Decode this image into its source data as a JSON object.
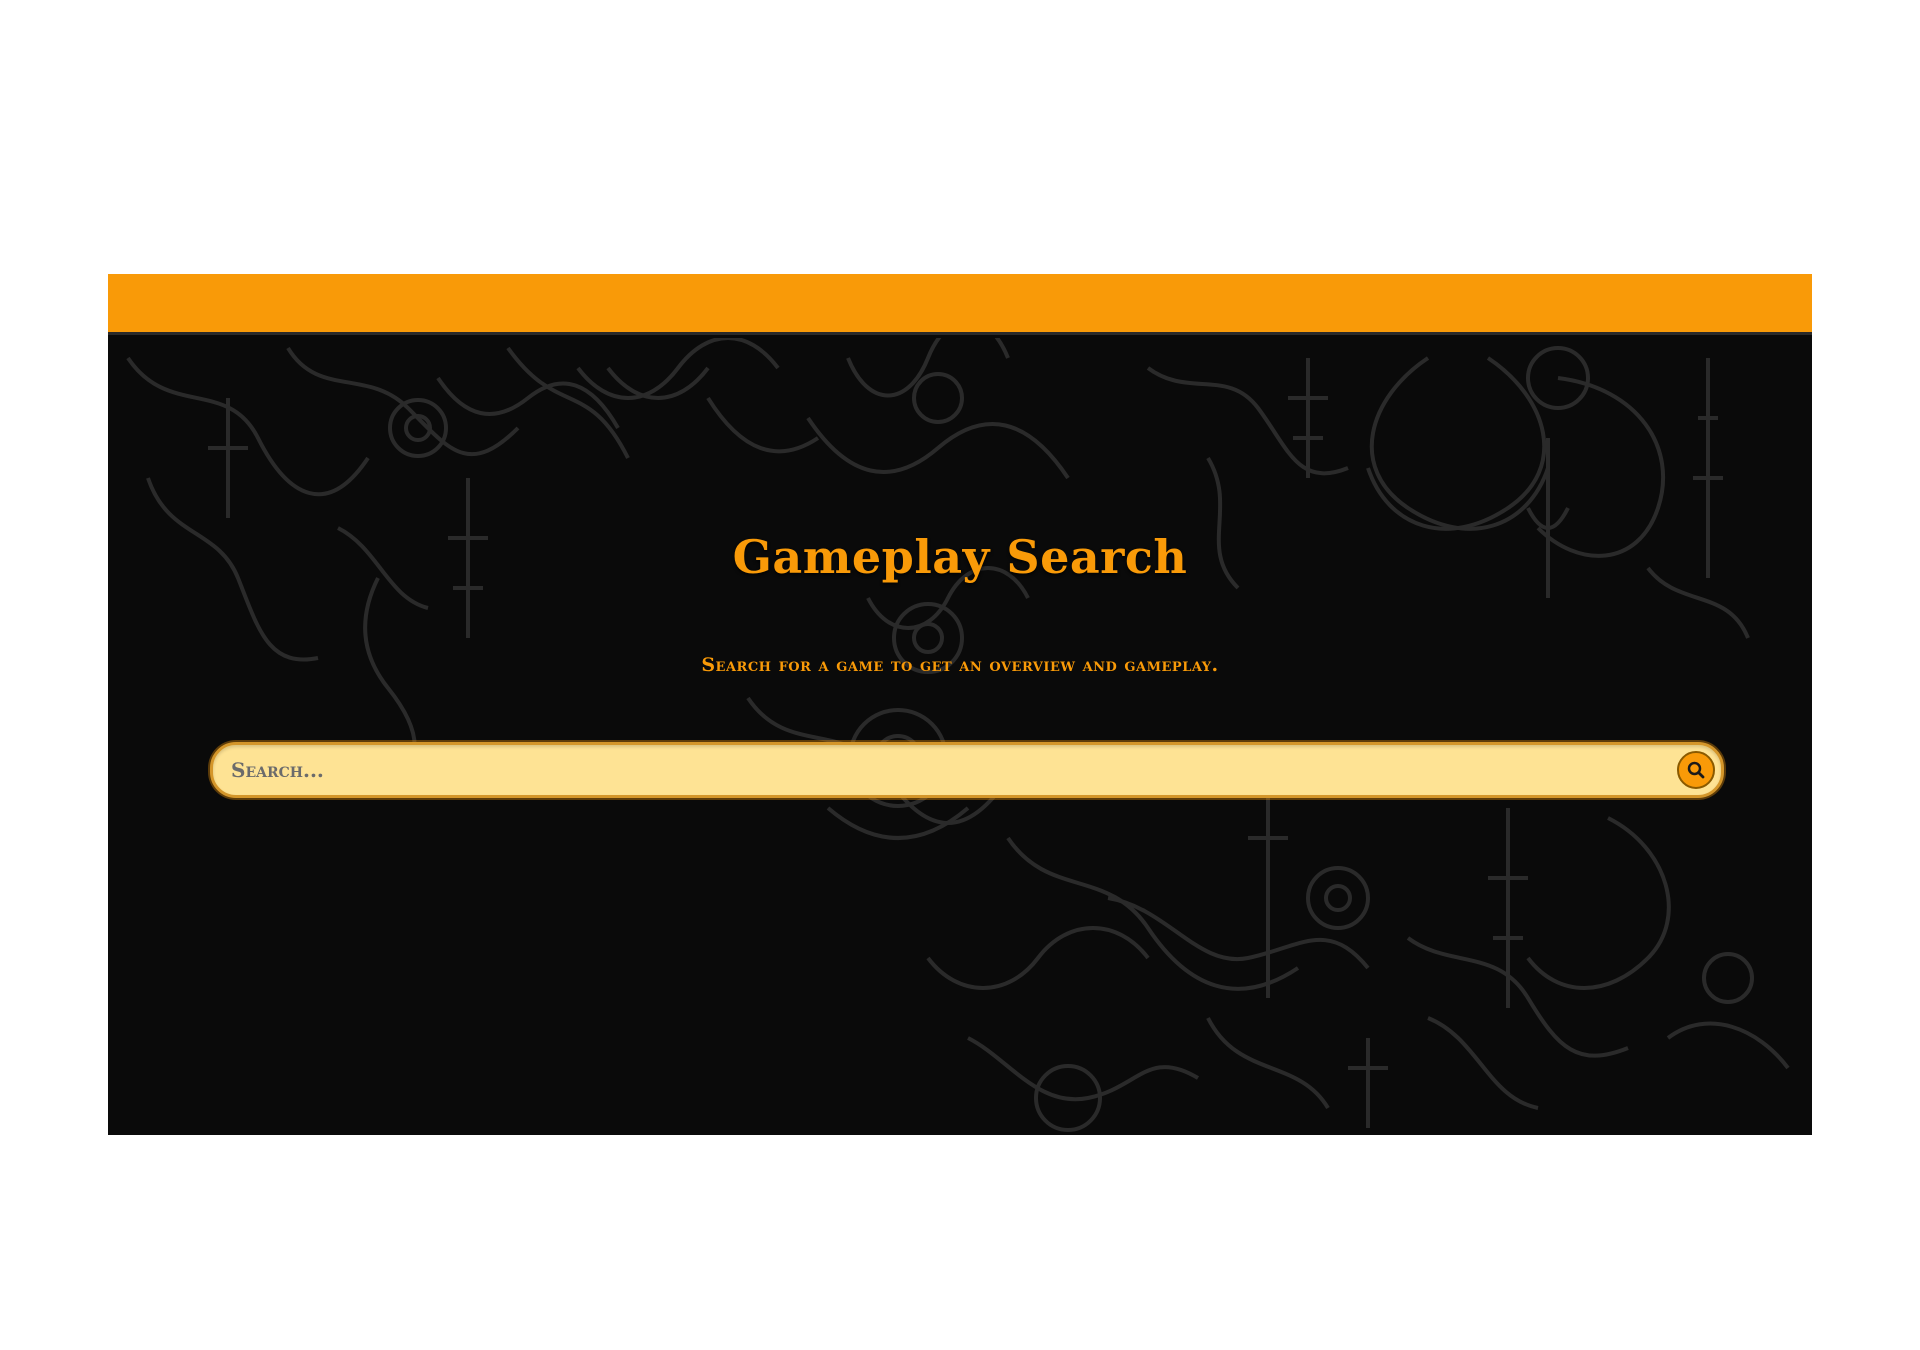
{
  "header": {
    "accent_color": "#f99a08"
  },
  "hero": {
    "title": "Gameplay Search",
    "subtitle": "Search for a game to get an overview and gameplay."
  },
  "search": {
    "placeholder": "Search...",
    "value": "",
    "button_icon": "search-icon"
  },
  "colors": {
    "background": "#0a0a0a",
    "accent": "#f99a08",
    "search_fill": "#fee394",
    "ornament": "#2e2e2e"
  }
}
